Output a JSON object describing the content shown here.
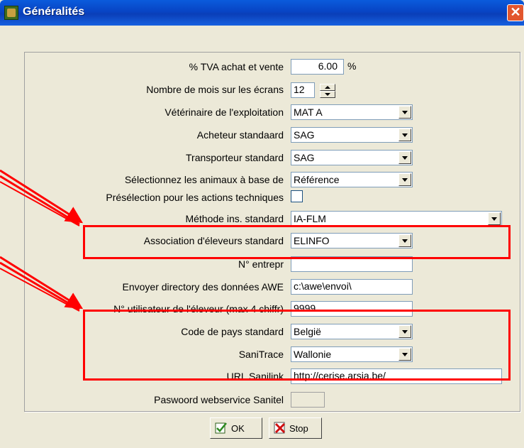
{
  "window": {
    "title": "Généralités",
    "close": "✕"
  },
  "form": {
    "rows": [
      {
        "label": "% TVA achat et vente",
        "value": "6.00",
        "unit": "%"
      },
      {
        "label": "Nombre de mois sur les écrans",
        "value": "12"
      },
      {
        "label": "Vétérinaire de l'exploitation",
        "value": "MAT A"
      },
      {
        "label": "Acheteur standaard",
        "value": "SAG"
      },
      {
        "label": "Transporteur standard",
        "value": "SAG"
      },
      {
        "label": "Sélectionnez les animaux à base de",
        "value": "Référence"
      },
      {
        "label": "Présélection pour les actions techniques",
        "checked": false
      },
      {
        "label": "Méthode ins. standard",
        "value": "IA-FLM"
      },
      {
        "label": "Association d'éleveurs standard",
        "value": "ELINFO"
      },
      {
        "label": "N° entrepr",
        "value": ""
      },
      {
        "label": "Envoyer directory des données AWE",
        "value": "c:\\awe\\envoi\\"
      },
      {
        "label": "N° utilisateur de l'éleveur (max 4 chiffr)",
        "value": "9999"
      },
      {
        "label": "Code de pays standard",
        "value": "België"
      },
      {
        "label": "SaniTrace",
        "value": "Wallonie"
      },
      {
        "label": "URL Sanilink",
        "value": "http://cerise.arsia.be/"
      },
      {
        "label": "Paswoord webservice Sanitel",
        "value": ""
      }
    ]
  },
  "buttons": {
    "ok": "OK",
    "stop": "Stop"
  },
  "colors": {
    "highlight": "#ff0000",
    "titlebar": "#0a5bdc",
    "window_bg": "#ece9d8"
  }
}
